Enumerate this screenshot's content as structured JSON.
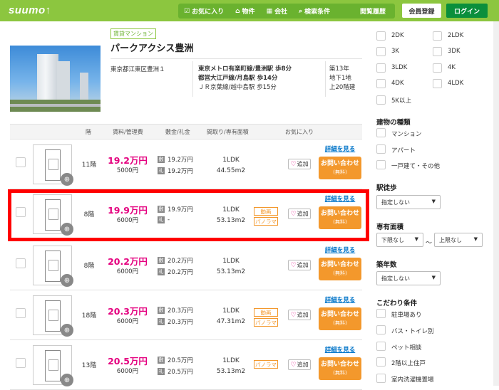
{
  "header": {
    "logo": "suumo↑",
    "nav": [
      {
        "icon": "☑",
        "label": "お気に入り"
      },
      {
        "icon": "⌂",
        "label": "物件"
      },
      {
        "icon": "▦",
        "label": "会社"
      },
      {
        "icon": "⌕",
        "label": "検索条件"
      }
    ],
    "history": "閲覧履歴",
    "register": "会員登録",
    "login": "ログイン"
  },
  "building": {
    "tag": "賃貸マンション",
    "name": "パークアクシス豊洲",
    "address": "東京都江東区豊洲１",
    "access": [
      "東京メトロ有楽町線/豊洲駅 歩8分",
      "都営大江戸線/月島駅 歩14分",
      "ＪＲ京葉線/越中島駅 歩15分"
    ],
    "info": [
      "築13年",
      "地下1地",
      "上20階建"
    ]
  },
  "table": {
    "headers": {
      "floor": "階",
      "rent": "賃料/管理費",
      "deposit": "敷金/礼金",
      "layout": "間取り/専有面積",
      "fav": "お気に入り"
    },
    "detail_label": "詳細を見る",
    "inquiry_label": "お問い合わせ",
    "inquiry_sub": "(無料)",
    "fav_label": "追加",
    "icon_shiki": "敷",
    "icon_rei": "礼",
    "rows": [
      {
        "floor": "11階",
        "rent": "19.2万円",
        "fee": "5000円",
        "deposit": "19.2万円",
        "key": "19.2万円",
        "layout": "1LDK",
        "area": "44.55m2",
        "badges": []
      },
      {
        "floor": "8階",
        "rent": "19.9万円",
        "fee": "6000円",
        "deposit": "19.9万円",
        "key": "-",
        "layout": "1LDK",
        "area": "53.13m2",
        "badges": [
          "動画",
          "パノラマ"
        ]
      },
      {
        "floor": "8階",
        "rent": "20.2万円",
        "fee": "6000円",
        "deposit": "20.2万円",
        "key": "20.2万円",
        "layout": "1LDK",
        "area": "53.13m2",
        "badges": []
      },
      {
        "floor": "18階",
        "rent": "20.3万円",
        "fee": "6000円",
        "deposit": "20.3万円",
        "key": "20.3万円",
        "layout": "1LDK",
        "area": "47.31m2",
        "badges": [
          "動画",
          "パノラマ"
        ]
      },
      {
        "floor": "13階",
        "rent": "20.5万円",
        "fee": "6000円",
        "deposit": "20.5万円",
        "key": "20.5万円",
        "layout": "1LDK",
        "area": "53.13m2",
        "badges": [
          "パノラマ"
        ]
      }
    ]
  },
  "sidebar": {
    "layouts": [
      [
        "2DK",
        "2LDK"
      ],
      [
        "3K",
        "3DK"
      ],
      [
        "3LDK",
        "4K"
      ],
      [
        "4DK",
        "4LDK"
      ],
      [
        "5K以上",
        ""
      ]
    ],
    "type_title": "建物の種類",
    "types": [
      "マンション",
      "アパート",
      "一戸建て・その他"
    ],
    "walk_title": "駅徒歩",
    "walk_value": "指定しない",
    "area_title": "専有面積",
    "area_min": "下限なし",
    "area_max": "上限なし",
    "tilde": "〜",
    "age_title": "築年数",
    "age_value": "指定しない",
    "pref_title": "こだわり条件",
    "prefs": [
      "駐車場あり",
      "バス・トイレ別",
      "ペット相談",
      "2階以上住戸",
      "室内洗濯機置場"
    ]
  }
}
